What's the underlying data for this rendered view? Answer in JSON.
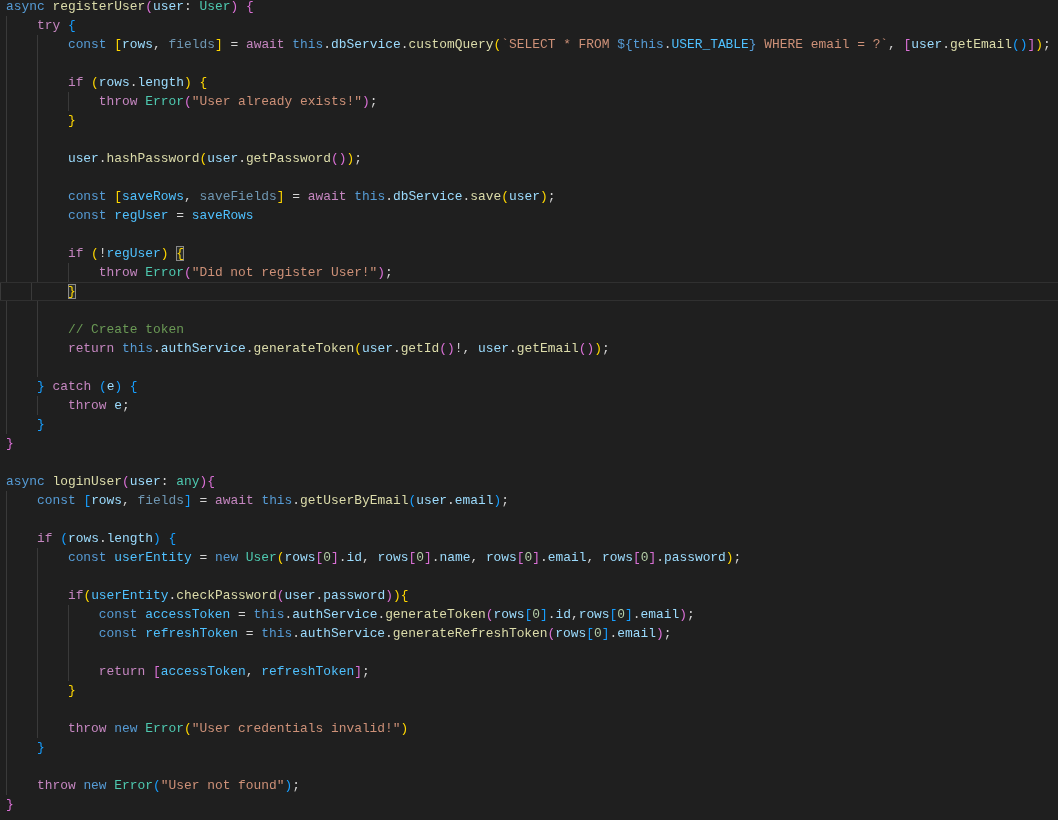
{
  "editor": {
    "lines": [
      {
        "kind": "code",
        "tokens": [
          {
            "text": "async ",
            "kind": "keyword"
          },
          {
            "text": "registerUser",
            "kind": "function"
          },
          {
            "text": "(",
            "kind": "open"
          },
          {
            "text": "user",
            "kind": "variable"
          },
          {
            "text": ": ",
            "kind": "punctuation"
          },
          {
            "text": "User",
            "kind": "type"
          },
          {
            "text": ") ",
            "kind": "close"
          },
          {
            "text": "{",
            "kind": "open"
          }
        ]
      },
      {
        "kind": "code",
        "tokens": [
          {
            "text": "    try ",
            "kind": "control"
          },
          {
            "text": "{",
            "kind": "open"
          }
        ]
      },
      {
        "kind": "code",
        "tokens": [
          {
            "text": "        const ",
            "kind": "keyword"
          },
          {
            "text": "[",
            "kind": "open"
          },
          {
            "text": "rows",
            "kind": "variable"
          },
          {
            "text": ", ",
            "kind": "punctuation"
          },
          {
            "text": "fields",
            "kind": "unused"
          },
          {
            "text": "]",
            "kind": "close"
          },
          {
            "text": " = ",
            "kind": "punctuation"
          },
          {
            "text": "await ",
            "kind": "control"
          },
          {
            "text": "this",
            "kind": "keyword"
          },
          {
            "text": ".",
            "kind": "punctuation"
          },
          {
            "text": "dbService",
            "kind": "variable"
          },
          {
            "text": ".",
            "kind": "punctuation"
          },
          {
            "text": "customQuery",
            "kind": "function"
          },
          {
            "text": "(",
            "kind": "open"
          },
          {
            "text": "`SELECT * FROM ",
            "kind": "string"
          },
          {
            "text": "${this",
            "kind": "keyword"
          },
          {
            "text": ".",
            "kind": "punctuation"
          },
          {
            "text": "USER_TABLE",
            "kind": "constant"
          },
          {
            "text": "}",
            "kind": "keyword"
          },
          {
            "text": " WHERE email = ?`",
            "kind": "string"
          },
          {
            "text": ", ",
            "kind": "punctuation"
          },
          {
            "text": "[",
            "kind": "open"
          },
          {
            "text": "user",
            "kind": "variable"
          },
          {
            "text": ".",
            "kind": "punctuation"
          },
          {
            "text": "getEmail",
            "kind": "function"
          },
          {
            "text": "(",
            "kind": "open"
          },
          {
            "text": ")",
            "kind": "close"
          },
          {
            "text": "]",
            "kind": "close"
          },
          {
            "text": ")",
            "kind": "close"
          },
          {
            "text": ";",
            "kind": "punctuation"
          }
        ]
      },
      {
        "kind": "blank"
      },
      {
        "kind": "code",
        "tokens": [
          {
            "text": "        if ",
            "kind": "control"
          },
          {
            "text": "(",
            "kind": "open"
          },
          {
            "text": "rows",
            "kind": "variable"
          },
          {
            "text": ".",
            "kind": "punctuation"
          },
          {
            "text": "length",
            "kind": "variable"
          },
          {
            "text": ") ",
            "kind": "close"
          },
          {
            "text": "{",
            "kind": "open"
          }
        ]
      },
      {
        "kind": "code",
        "tokens": [
          {
            "text": "            throw ",
            "kind": "control"
          },
          {
            "text": "Error",
            "kind": "type"
          },
          {
            "text": "(",
            "kind": "open"
          },
          {
            "text": "\"User already exists!\"",
            "kind": "string"
          },
          {
            "text": ")",
            "kind": "close"
          },
          {
            "text": ";",
            "kind": "punctuation"
          }
        ]
      },
      {
        "kind": "code",
        "tokens": [
          {
            "text": "        }",
            "kind": "close"
          }
        ]
      },
      {
        "kind": "blank"
      },
      {
        "kind": "code",
        "tokens": [
          {
            "text": "        user",
            "kind": "variable"
          },
          {
            "text": ".",
            "kind": "punctuation"
          },
          {
            "text": "hashPassword",
            "kind": "function"
          },
          {
            "text": "(",
            "kind": "open"
          },
          {
            "text": "user",
            "kind": "variable"
          },
          {
            "text": ".",
            "kind": "punctuation"
          },
          {
            "text": "getPassword",
            "kind": "function"
          },
          {
            "text": "(",
            "kind": "open"
          },
          {
            "text": ")",
            "kind": "close"
          },
          {
            "text": ")",
            "kind": "close"
          },
          {
            "text": ";",
            "kind": "punctuation"
          }
        ]
      },
      {
        "kind": "blank"
      },
      {
        "kind": "code",
        "tokens": [
          {
            "text": "        const ",
            "kind": "keyword"
          },
          {
            "text": "[",
            "kind": "open"
          },
          {
            "text": "saveRows",
            "kind": "constant"
          },
          {
            "text": ", ",
            "kind": "punctuation"
          },
          {
            "text": "saveFields",
            "kind": "unused"
          },
          {
            "text": "]",
            "kind": "close"
          },
          {
            "text": " = ",
            "kind": "punctuation"
          },
          {
            "text": "await ",
            "kind": "control"
          },
          {
            "text": "this",
            "kind": "keyword"
          },
          {
            "text": ".",
            "kind": "punctuation"
          },
          {
            "text": "dbService",
            "kind": "variable"
          },
          {
            "text": ".",
            "kind": "punctuation"
          },
          {
            "text": "save",
            "kind": "function"
          },
          {
            "text": "(",
            "kind": "open"
          },
          {
            "text": "user",
            "kind": "variable"
          },
          {
            "text": ")",
            "kind": "close"
          },
          {
            "text": ";",
            "kind": "punctuation"
          }
        ]
      },
      {
        "kind": "code",
        "tokens": [
          {
            "text": "        const ",
            "kind": "keyword"
          },
          {
            "text": "regUser",
            "kind": "constant"
          },
          {
            "text": " = ",
            "kind": "punctuation"
          },
          {
            "text": "saveRows",
            "kind": "constant"
          }
        ]
      },
      {
        "kind": "blank"
      },
      {
        "kind": "code",
        "tokens": [
          {
            "text": "        if ",
            "kind": "control"
          },
          {
            "text": "(",
            "kind": "open"
          },
          {
            "text": "!",
            "kind": "punctuation"
          },
          {
            "text": "regUser",
            "kind": "constant"
          },
          {
            "text": ") ",
            "kind": "close"
          },
          {
            "text": "{",
            "kind": "open",
            "matched": true
          }
        ]
      },
      {
        "kind": "code",
        "tokens": [
          {
            "text": "            throw ",
            "kind": "control"
          },
          {
            "text": "Error",
            "kind": "type"
          },
          {
            "text": "(",
            "kind": "open"
          },
          {
            "text": "\"Did not register User!\"",
            "kind": "string"
          },
          {
            "text": ")",
            "kind": "close"
          },
          {
            "text": ";",
            "kind": "punctuation"
          }
        ]
      },
      {
        "kind": "code",
        "current": true,
        "tokens": [
          {
            "text": "        }",
            "kind": "close",
            "matched": true
          }
        ]
      },
      {
        "kind": "blank"
      },
      {
        "kind": "code",
        "tokens": [
          {
            "text": "        // Create token",
            "kind": "comment"
          }
        ]
      },
      {
        "kind": "code",
        "tokens": [
          {
            "text": "        return ",
            "kind": "control"
          },
          {
            "text": "this",
            "kind": "keyword"
          },
          {
            "text": ".",
            "kind": "punctuation"
          },
          {
            "text": "authService",
            "kind": "variable"
          },
          {
            "text": ".",
            "kind": "punctuation"
          },
          {
            "text": "generateToken",
            "kind": "function"
          },
          {
            "text": "(",
            "kind": "open"
          },
          {
            "text": "user",
            "kind": "variable"
          },
          {
            "text": ".",
            "kind": "punctuation"
          },
          {
            "text": "getId",
            "kind": "function"
          },
          {
            "text": "(",
            "kind": "open"
          },
          {
            "text": ")",
            "kind": "close"
          },
          {
            "text": "!, ",
            "kind": "punctuation"
          },
          {
            "text": "user",
            "kind": "variable"
          },
          {
            "text": ".",
            "kind": "punctuation"
          },
          {
            "text": "getEmail",
            "kind": "function"
          },
          {
            "text": "(",
            "kind": "open"
          },
          {
            "text": ")",
            "kind": "close"
          },
          {
            "text": ")",
            "kind": "close"
          },
          {
            "text": ";",
            "kind": "punctuation"
          }
        ]
      },
      {
        "kind": "blank"
      },
      {
        "kind": "code",
        "tokens": [
          {
            "text": "    }",
            "kind": "close"
          },
          {
            "text": " catch ",
            "kind": "control"
          },
          {
            "text": "(",
            "kind": "open"
          },
          {
            "text": "e",
            "kind": "variable"
          },
          {
            "text": ") ",
            "kind": "close"
          },
          {
            "text": "{",
            "kind": "open"
          }
        ]
      },
      {
        "kind": "code",
        "tokens": [
          {
            "text": "        throw ",
            "kind": "control"
          },
          {
            "text": "e",
            "kind": "variable"
          },
          {
            "text": ";",
            "kind": "punctuation"
          }
        ]
      },
      {
        "kind": "code",
        "tokens": [
          {
            "text": "    }",
            "kind": "close"
          }
        ]
      },
      {
        "kind": "code",
        "tokens": [
          {
            "text": "}",
            "kind": "close"
          }
        ]
      },
      {
        "kind": "blank"
      },
      {
        "kind": "code",
        "tokens": [
          {
            "text": "async ",
            "kind": "keyword"
          },
          {
            "text": "loginUser",
            "kind": "function"
          },
          {
            "text": "(",
            "kind": "open"
          },
          {
            "text": "user",
            "kind": "variable"
          },
          {
            "text": ": ",
            "kind": "punctuation"
          },
          {
            "text": "any",
            "kind": "type"
          },
          {
            "text": ")",
            "kind": "close"
          },
          {
            "text": "{",
            "kind": "open"
          }
        ]
      },
      {
        "kind": "code",
        "tokens": [
          {
            "text": "    const ",
            "kind": "keyword"
          },
          {
            "text": "[",
            "kind": "open"
          },
          {
            "text": "rows",
            "kind": "variable"
          },
          {
            "text": ", ",
            "kind": "punctuation"
          },
          {
            "text": "fields",
            "kind": "unused"
          },
          {
            "text": "]",
            "kind": "close"
          },
          {
            "text": " = ",
            "kind": "punctuation"
          },
          {
            "text": "await ",
            "kind": "control"
          },
          {
            "text": "this",
            "kind": "keyword"
          },
          {
            "text": ".",
            "kind": "punctuation"
          },
          {
            "text": "getUserByEmail",
            "kind": "function"
          },
          {
            "text": "(",
            "kind": "open"
          },
          {
            "text": "user",
            "kind": "variable"
          },
          {
            "text": ".",
            "kind": "punctuation"
          },
          {
            "text": "email",
            "kind": "variable"
          },
          {
            "text": ")",
            "kind": "close"
          },
          {
            "text": ";",
            "kind": "punctuation"
          }
        ]
      },
      {
        "kind": "blank"
      },
      {
        "kind": "code",
        "tokens": [
          {
            "text": "    if ",
            "kind": "control"
          },
          {
            "text": "(",
            "kind": "open"
          },
          {
            "text": "rows",
            "kind": "variable"
          },
          {
            "text": ".",
            "kind": "punctuation"
          },
          {
            "text": "length",
            "kind": "variable"
          },
          {
            "text": ") ",
            "kind": "close"
          },
          {
            "text": "{",
            "kind": "open"
          }
        ]
      },
      {
        "kind": "code",
        "tokens": [
          {
            "text": "        const ",
            "kind": "keyword"
          },
          {
            "text": "userEntity",
            "kind": "constant"
          },
          {
            "text": " = ",
            "kind": "punctuation"
          },
          {
            "text": "new ",
            "kind": "keyword"
          },
          {
            "text": "User",
            "kind": "type"
          },
          {
            "text": "(",
            "kind": "open"
          },
          {
            "text": "rows",
            "kind": "variable"
          },
          {
            "text": "[",
            "kind": "open"
          },
          {
            "text": "0",
            "kind": "number"
          },
          {
            "text": "]",
            "kind": "close"
          },
          {
            "text": ".",
            "kind": "punctuation"
          },
          {
            "text": "id",
            "kind": "variable"
          },
          {
            "text": ", ",
            "kind": "punctuation"
          },
          {
            "text": "rows",
            "kind": "variable"
          },
          {
            "text": "[",
            "kind": "open"
          },
          {
            "text": "0",
            "kind": "number"
          },
          {
            "text": "]",
            "kind": "close"
          },
          {
            "text": ".",
            "kind": "punctuation"
          },
          {
            "text": "name",
            "kind": "variable"
          },
          {
            "text": ", ",
            "kind": "punctuation"
          },
          {
            "text": "rows",
            "kind": "variable"
          },
          {
            "text": "[",
            "kind": "open"
          },
          {
            "text": "0",
            "kind": "number"
          },
          {
            "text": "]",
            "kind": "close"
          },
          {
            "text": ".",
            "kind": "punctuation"
          },
          {
            "text": "email",
            "kind": "variable"
          },
          {
            "text": ", ",
            "kind": "punctuation"
          },
          {
            "text": "rows",
            "kind": "variable"
          },
          {
            "text": "[",
            "kind": "open"
          },
          {
            "text": "0",
            "kind": "number"
          },
          {
            "text": "]",
            "kind": "close"
          },
          {
            "text": ".",
            "kind": "punctuation"
          },
          {
            "text": "password",
            "kind": "variable"
          },
          {
            "text": ")",
            "kind": "close"
          },
          {
            "text": ";",
            "kind": "punctuation"
          }
        ]
      },
      {
        "kind": "blank"
      },
      {
        "kind": "code",
        "tokens": [
          {
            "text": "        if",
            "kind": "control"
          },
          {
            "text": "(",
            "kind": "open"
          },
          {
            "text": "userEntity",
            "kind": "constant"
          },
          {
            "text": ".",
            "kind": "punctuation"
          },
          {
            "text": "checkPassword",
            "kind": "function"
          },
          {
            "text": "(",
            "kind": "open"
          },
          {
            "text": "user",
            "kind": "variable"
          },
          {
            "text": ".",
            "kind": "punctuation"
          },
          {
            "text": "password",
            "kind": "variable"
          },
          {
            "text": ")",
            "kind": "close"
          },
          {
            "text": ")",
            "kind": "close"
          },
          {
            "text": "{",
            "kind": "open"
          }
        ]
      },
      {
        "kind": "code",
        "tokens": [
          {
            "text": "            const ",
            "kind": "keyword"
          },
          {
            "text": "accessToken",
            "kind": "constant"
          },
          {
            "text": " = ",
            "kind": "punctuation"
          },
          {
            "text": "this",
            "kind": "keyword"
          },
          {
            "text": ".",
            "kind": "punctuation"
          },
          {
            "text": "authService",
            "kind": "variable"
          },
          {
            "text": ".",
            "kind": "punctuation"
          },
          {
            "text": "generateToken",
            "kind": "function"
          },
          {
            "text": "(",
            "kind": "open"
          },
          {
            "text": "rows",
            "kind": "variable"
          },
          {
            "text": "[",
            "kind": "open"
          },
          {
            "text": "0",
            "kind": "number"
          },
          {
            "text": "]",
            "kind": "close"
          },
          {
            "text": ".",
            "kind": "punctuation"
          },
          {
            "text": "id",
            "kind": "variable"
          },
          {
            "text": ",",
            "kind": "punctuation"
          },
          {
            "text": "rows",
            "kind": "variable"
          },
          {
            "text": "[",
            "kind": "open"
          },
          {
            "text": "0",
            "kind": "number"
          },
          {
            "text": "]",
            "kind": "close"
          },
          {
            "text": ".",
            "kind": "punctuation"
          },
          {
            "text": "email",
            "kind": "variable"
          },
          {
            "text": ")",
            "kind": "close"
          },
          {
            "text": ";",
            "kind": "punctuation"
          }
        ]
      },
      {
        "kind": "code",
        "tokens": [
          {
            "text": "            const ",
            "kind": "keyword"
          },
          {
            "text": "refreshToken",
            "kind": "constant"
          },
          {
            "text": " = ",
            "kind": "punctuation"
          },
          {
            "text": "this",
            "kind": "keyword"
          },
          {
            "text": ".",
            "kind": "punctuation"
          },
          {
            "text": "authService",
            "kind": "variable"
          },
          {
            "text": ".",
            "kind": "punctuation"
          },
          {
            "text": "generateRefreshToken",
            "kind": "function"
          },
          {
            "text": "(",
            "kind": "open"
          },
          {
            "text": "rows",
            "kind": "variable"
          },
          {
            "text": "[",
            "kind": "open"
          },
          {
            "text": "0",
            "kind": "number"
          },
          {
            "text": "]",
            "kind": "close"
          },
          {
            "text": ".",
            "kind": "punctuation"
          },
          {
            "text": "email",
            "kind": "variable"
          },
          {
            "text": ")",
            "kind": "close"
          },
          {
            "text": ";",
            "kind": "punctuation"
          }
        ]
      },
      {
        "kind": "blank"
      },
      {
        "kind": "code",
        "tokens": [
          {
            "text": "            return ",
            "kind": "control"
          },
          {
            "text": "[",
            "kind": "open"
          },
          {
            "text": "accessToken",
            "kind": "constant"
          },
          {
            "text": ", ",
            "kind": "punctuation"
          },
          {
            "text": "refreshToken",
            "kind": "constant"
          },
          {
            "text": "]",
            "kind": "close"
          },
          {
            "text": ";",
            "kind": "punctuation"
          }
        ]
      },
      {
        "kind": "code",
        "tokens": [
          {
            "text": "        }",
            "kind": "close"
          }
        ]
      },
      {
        "kind": "blank"
      },
      {
        "kind": "code",
        "tokens": [
          {
            "text": "        throw ",
            "kind": "control"
          },
          {
            "text": "new ",
            "kind": "keyword"
          },
          {
            "text": "Error",
            "kind": "type"
          },
          {
            "text": "(",
            "kind": "open"
          },
          {
            "text": "\"User credentials invalid!\"",
            "kind": "string"
          },
          {
            "text": ")",
            "kind": "close"
          }
        ]
      },
      {
        "kind": "code",
        "tokens": [
          {
            "text": "    }",
            "kind": "close"
          }
        ]
      },
      {
        "kind": "blank"
      },
      {
        "kind": "code",
        "tokens": [
          {
            "text": "    throw ",
            "kind": "control"
          },
          {
            "text": "new ",
            "kind": "keyword"
          },
          {
            "text": "Error",
            "kind": "type"
          },
          {
            "text": "(",
            "kind": "open"
          },
          {
            "text": "\"User not found\"",
            "kind": "string"
          },
          {
            "text": ")",
            "kind": "close"
          },
          {
            "text": ";",
            "kind": "punctuation"
          }
        ]
      },
      {
        "kind": "code",
        "tokens": [
          {
            "text": "}",
            "kind": "close"
          }
        ]
      }
    ]
  }
}
